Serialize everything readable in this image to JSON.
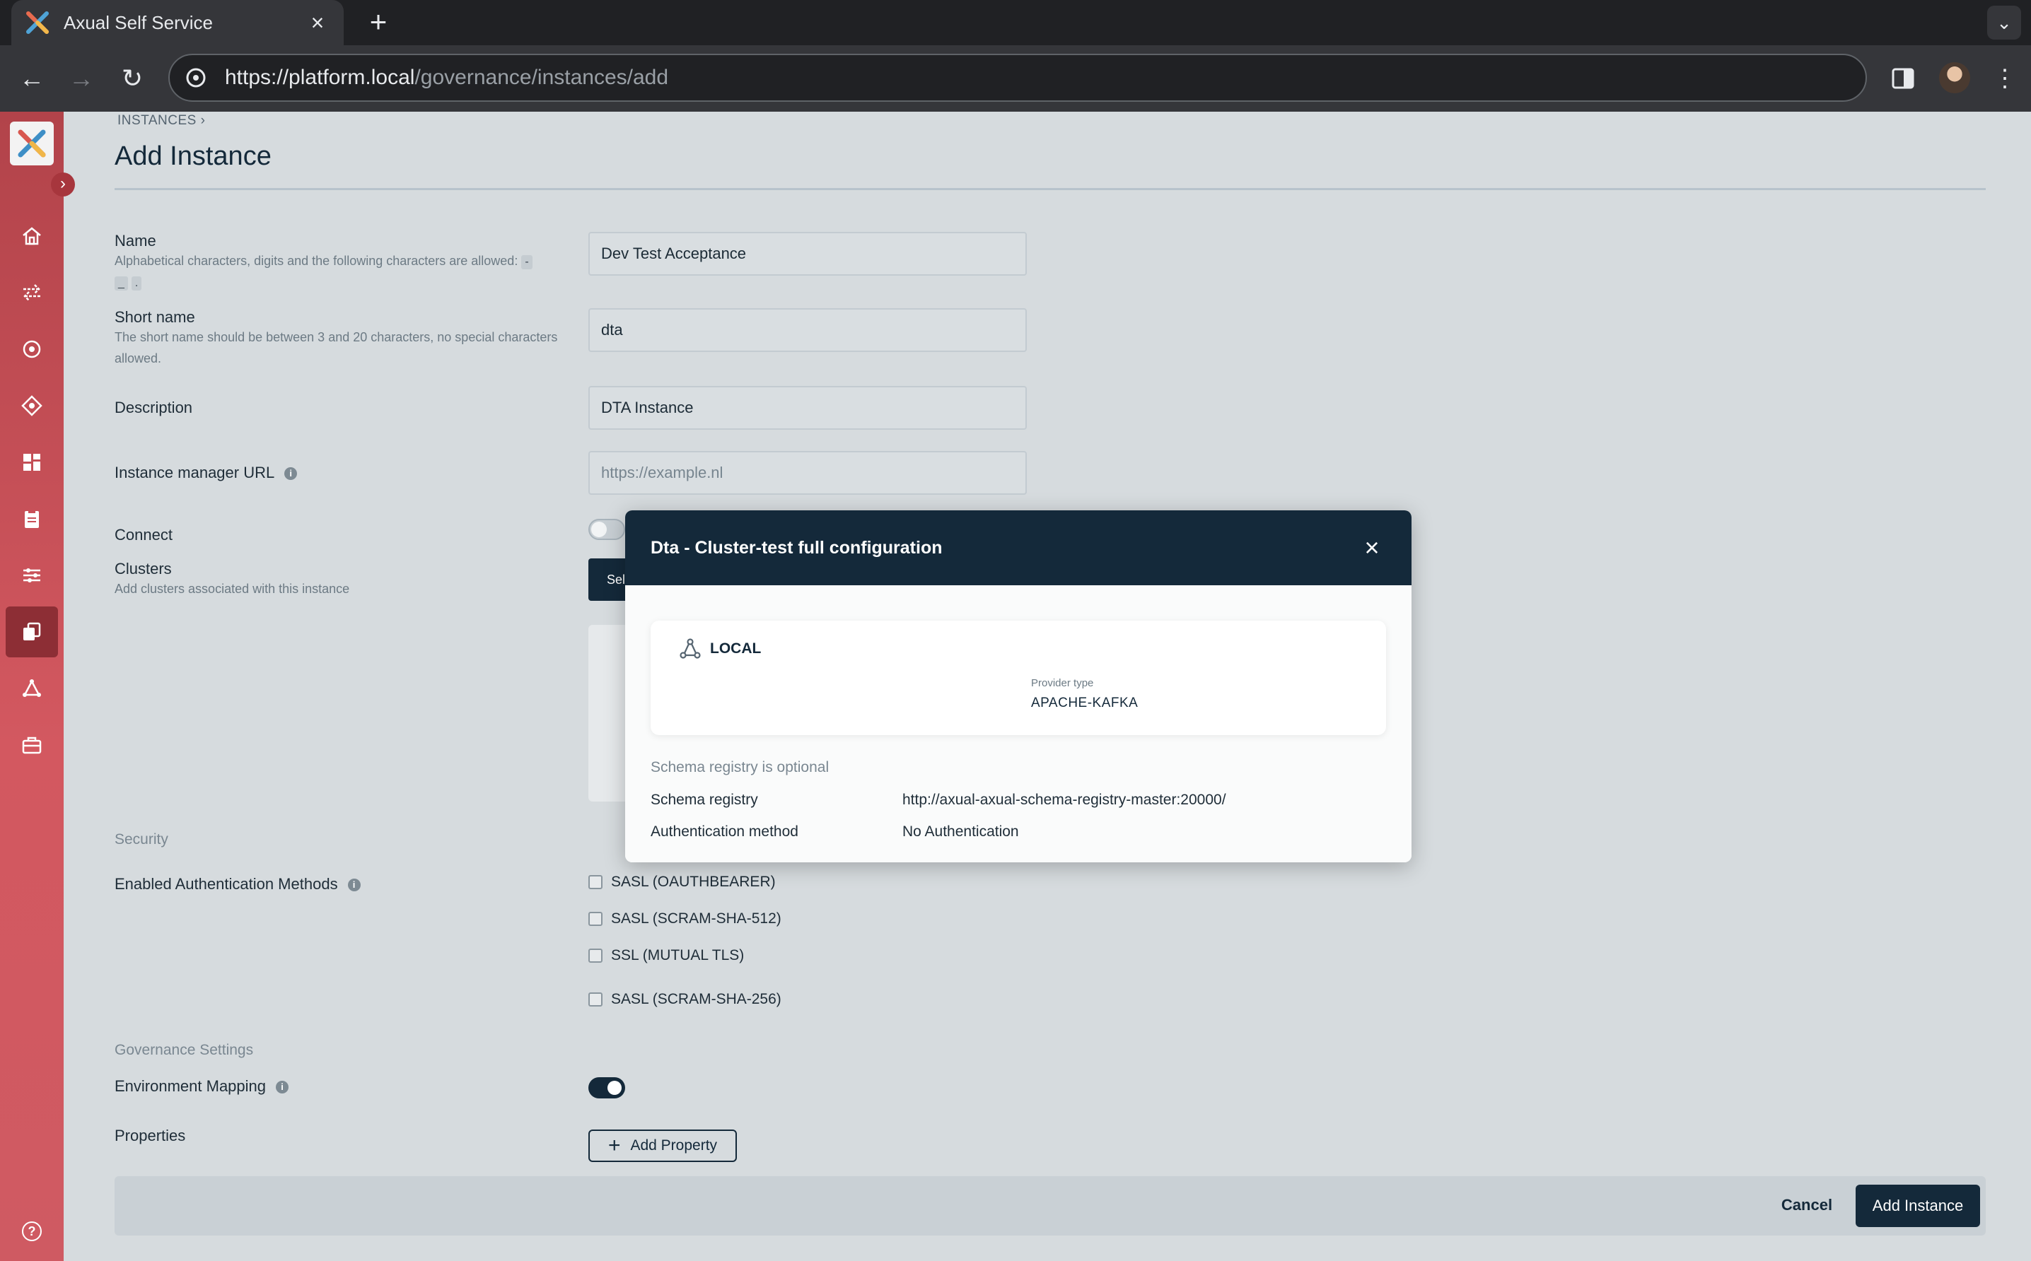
{
  "browser": {
    "tab_title": "Axual Self Service",
    "url_host": "https://platform.local",
    "url_path": "/governance/instances/add"
  },
  "breadcrumb": "INSTANCES",
  "page_title": "Add Instance",
  "form": {
    "name": {
      "label": "Name",
      "help": "Alphabetical characters, digits and the following characters are allowed:",
      "allowed_chars": [
        "-",
        "_",
        "."
      ],
      "value": "Dev Test Acceptance"
    },
    "short_name": {
      "label": "Short name",
      "help": "The short name should be between 3 and 20 characters, no special characters allowed.",
      "value": "dta"
    },
    "description": {
      "label": "Description",
      "value": "DTA Instance"
    },
    "instance_manager_url": {
      "label": "Instance manager URL",
      "placeholder": "https://example.nl",
      "value": ""
    },
    "connect": {
      "label": "Connect",
      "enabled": false
    },
    "clusters": {
      "label": "Clusters",
      "help": "Add clusters associated with this instance",
      "select_label": "Sel"
    }
  },
  "security": {
    "section_title": "Security",
    "auth_label": "Enabled Authentication Methods",
    "methods": [
      {
        "label": "SASL (OAUTHBEARER)",
        "checked": false
      },
      {
        "label": "SASL (SCRAM-SHA-512)",
        "checked": false
      },
      {
        "label": "SSL (MUTUAL TLS)",
        "checked": false
      },
      {
        "label": "SASL (SCRAM-SHA-256)",
        "checked": false
      }
    ]
  },
  "governance": {
    "section_title": "Governance Settings",
    "env_mapping_label": "Environment Mapping",
    "env_mapping_enabled": true,
    "properties_label": "Properties",
    "add_property_label": "Add Property"
  },
  "footer": {
    "cancel_label": "Cancel",
    "submit_label": "Add Instance"
  },
  "modal": {
    "title": "Dta - Cluster-test full configuration",
    "provider_name": "LOCAL",
    "provider_type_label": "Provider type",
    "provider_type_value": "APACHE-KAFKA",
    "schema_note": "Schema registry is optional",
    "schema_registry_label": "Schema registry",
    "schema_registry_value": "http://axual-axual-schema-registry-master:20000/",
    "auth_method_label": "Authentication method",
    "auth_method_value": "No Authentication"
  },
  "icons": {
    "sidebar": [
      "home-icon",
      "streams-icon",
      "target-icon",
      "diamond-icon",
      "dashboard-icon",
      "clipboard-icon",
      "sliders-icon",
      "instances-icon",
      "cluster-icon",
      "toolbox-icon"
    ],
    "brand_colors": {
      "navy": "#14293a",
      "sidebar": "#c94f57"
    }
  }
}
